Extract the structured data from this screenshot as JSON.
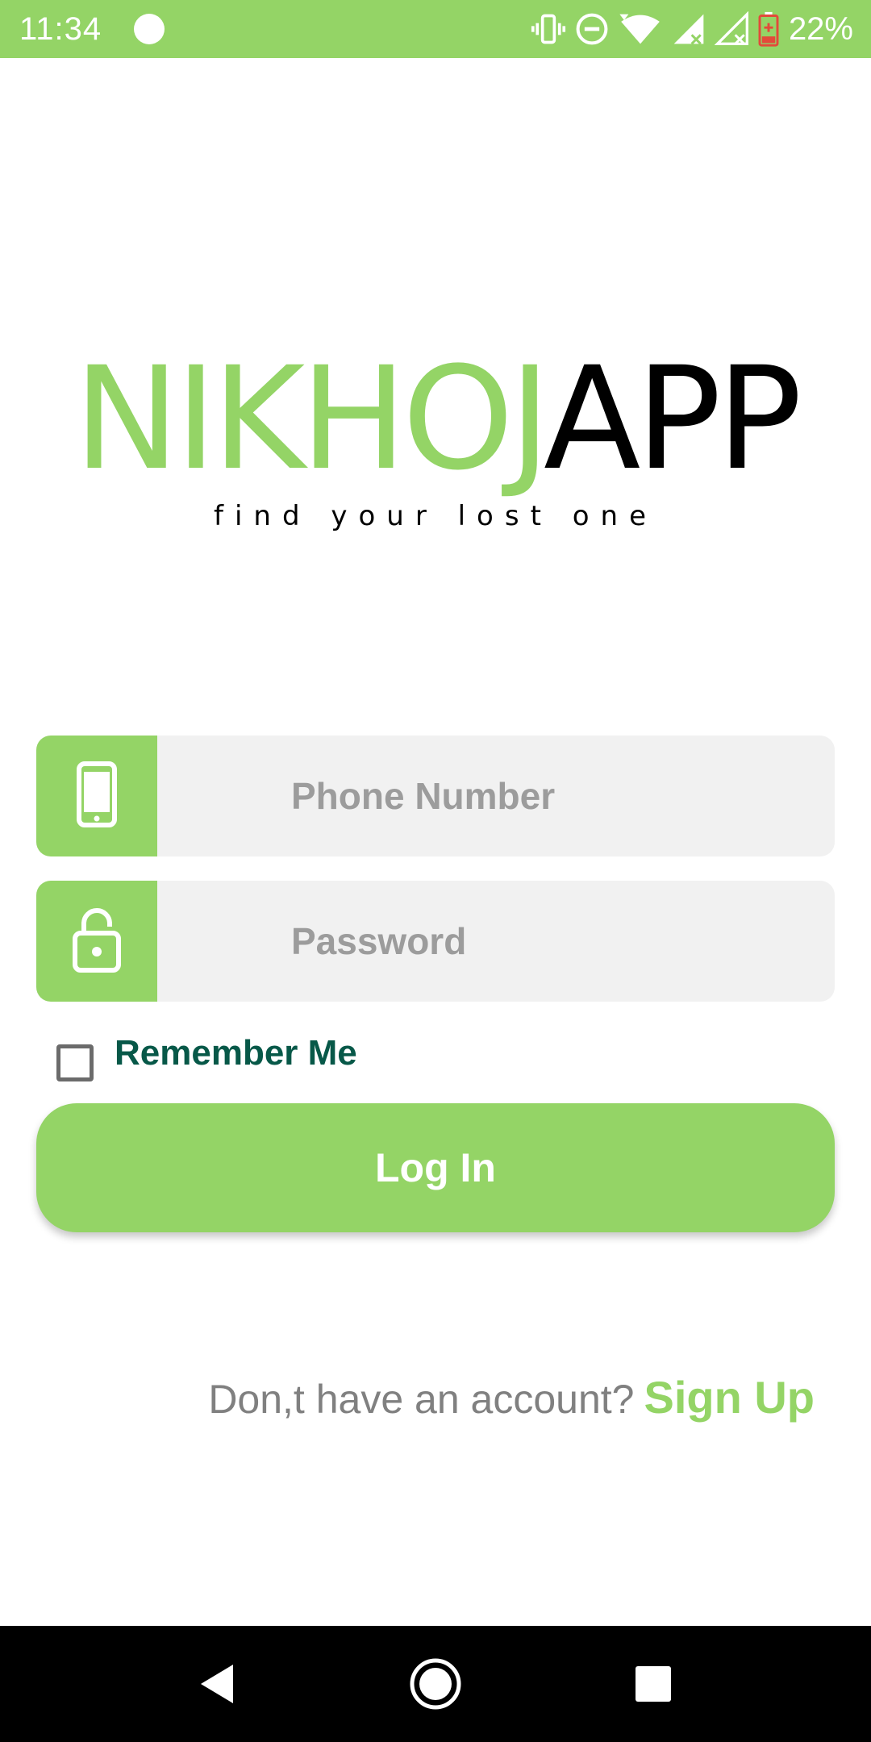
{
  "status_bar": {
    "time": "11:34",
    "battery": "22%",
    "icons": [
      "vibrate-icon",
      "do-not-disturb-icon",
      "wifi-icon",
      "signal-icon",
      "signal-icon",
      "battery-icon"
    ]
  },
  "logo": {
    "part1": "NIKHOJ",
    "part2": "APP",
    "tagline": "find your lost one"
  },
  "form": {
    "phone_placeholder": "Phone Number",
    "password_placeholder": "Password",
    "remember_label": "Remember Me",
    "login_label": "Log In"
  },
  "signup": {
    "prompt": "Don,t have an account?",
    "link": "Sign Up"
  },
  "colors": {
    "brand_green": "#94d466",
    "remember_text": "#075848",
    "field_bg": "#f1f1f1",
    "placeholder": "#9c9c9c"
  }
}
